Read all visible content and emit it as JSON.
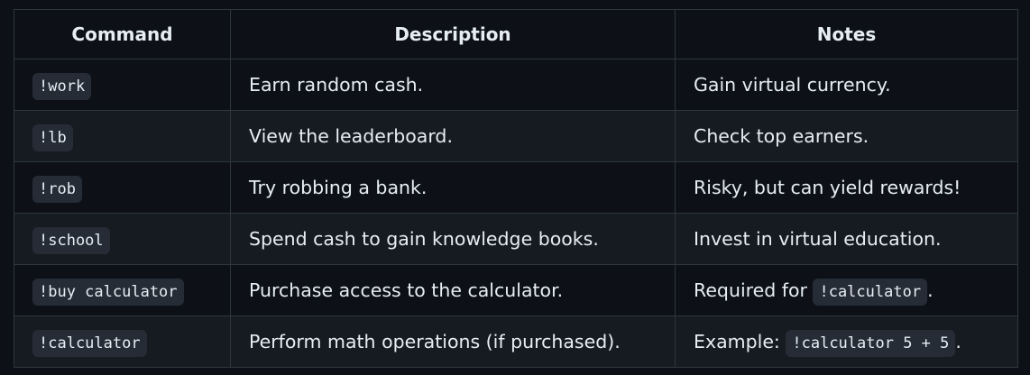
{
  "table": {
    "headers": {
      "command": "Command",
      "description": "Description",
      "notes": "Notes"
    },
    "rows": [
      {
        "command": "!work",
        "description": "Earn random cash.",
        "notes_text": "Gain virtual currency.",
        "notes_code": "",
        "notes_suffix": ""
      },
      {
        "command": "!lb",
        "description": "View the leaderboard.",
        "notes_text": "Check top earners.",
        "notes_code": "",
        "notes_suffix": ""
      },
      {
        "command": "!rob",
        "description": "Try robbing a bank.",
        "notes_text": "Risky, but can yield rewards!",
        "notes_code": "",
        "notes_suffix": ""
      },
      {
        "command": "!school",
        "description": "Spend cash to gain knowledge books.",
        "notes_text": "Invest in virtual education.",
        "notes_code": "",
        "notes_suffix": ""
      },
      {
        "command": "!buy calculator",
        "description": "Purchase access to the calculator.",
        "notes_text": "Required for ",
        "notes_code": "!calculator",
        "notes_suffix": "."
      },
      {
        "command": "!calculator",
        "description": "Perform math operations (if purchased).",
        "notes_text": "Example: ",
        "notes_code": "!calculator 5 + 5",
        "notes_suffix": "."
      }
    ]
  }
}
